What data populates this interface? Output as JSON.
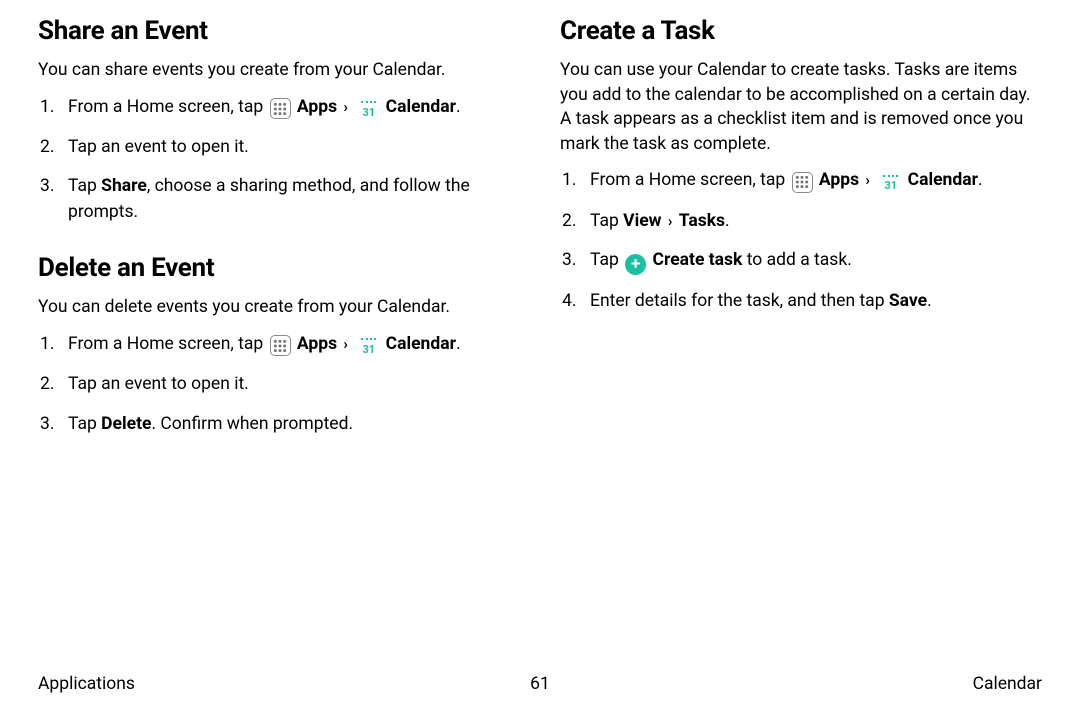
{
  "left": {
    "section1": {
      "heading": "Share an Event",
      "lead": "You can share events you create from your Calendar.",
      "step1_prefix": "From a Home screen, tap ",
      "apps_label": "Apps",
      "cal_label": "Calendar",
      "cal_day": "31",
      "step2": "Tap an event to open it.",
      "step3_a": "Tap ",
      "step3_share": "Share",
      "step3_b": ", choose a sharing method, and follow the prompts."
    },
    "section2": {
      "heading": "Delete an Event",
      "lead": "You can delete events you create from your Calendar.",
      "step1_prefix": "From a Home screen, tap ",
      "apps_label": "Apps",
      "cal_label": "Calendar",
      "cal_day": "31",
      "step2": "Tap an event to open it.",
      "step3_a": "Tap ",
      "step3_del": "Delete",
      "step3_b": ". Confirm when prompted."
    }
  },
  "right": {
    "section": {
      "heading": "Create a Task",
      "lead": "You can use your Calendar to create tasks. Tasks are items you add to the calendar to be accomplished on a certain day. A task appears as a checklist item and is removed once you mark the task as complete.",
      "step1_prefix": "From a Home screen, tap ",
      "apps_label": "Apps",
      "cal_label": "Calendar",
      "cal_day": "31",
      "step2_a": "Tap ",
      "step2_view": "View",
      "step2_tasks": "Tasks",
      "step3_a": "Tap ",
      "step3_create": "Create task",
      "step3_b": " to add a task.",
      "step4_a": "Enter details for the task, and then tap ",
      "step4_save": "Save",
      "period": "."
    }
  },
  "footer": {
    "left": "Applications",
    "center": "61",
    "right": "Calendar"
  },
  "glyphs": {
    "chevron": "›",
    "plus": "+"
  }
}
